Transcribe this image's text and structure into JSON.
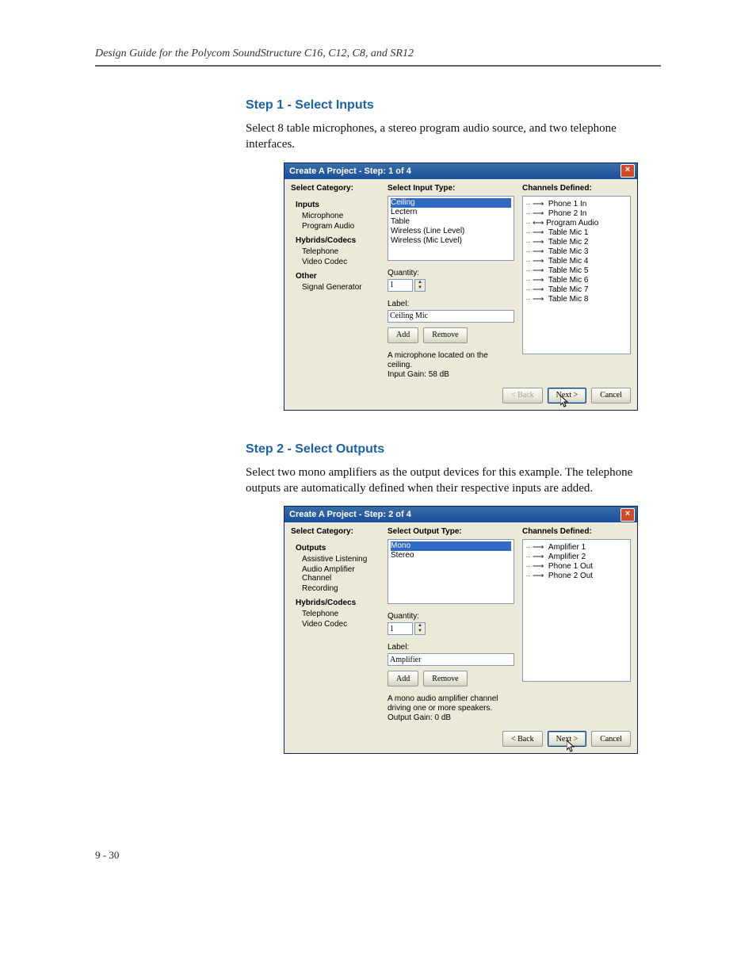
{
  "header": "Design Guide for the Polycom SoundStructure C16, C12, C8, and SR12",
  "step1": {
    "title": "Step 1 - Select Inputs",
    "paragraph": "Select 8 table microphones, a stereo program audio source, and two telephone interfaces.",
    "window_title": "Create A Project - Step: 1 of 4",
    "cat_head": "Select Category:",
    "type_head": "Select Input Type:",
    "ch_head": "Channels Defined:",
    "cats": {
      "g1": "Inputs",
      "g1a": "Microphone",
      "g1b": "Program Audio",
      "g2": "Hybrids/Codecs",
      "g2a": "Telephone",
      "g2b": "Video Codec",
      "g3": "Other",
      "g3a": "Signal Generator"
    },
    "types": {
      "t0": "Ceiling",
      "t1": "Lectern",
      "t2": "Table",
      "t3": "Wireless (Line Level)",
      "t4": "Wireless (Mic Level)"
    },
    "qty_label": "Quantity:",
    "qty": "1",
    "label_label": "Label:",
    "label": "Ceiling Mic",
    "add": "Add",
    "remove": "Remove",
    "desc1": "A microphone located on the ceiling.",
    "desc2": "Input Gain: 58 dB",
    "channels": {
      "c0": "Phone 1 In",
      "c1": "Phone 2 In",
      "c2": "Program Audio",
      "c3": "Table Mic 1",
      "c4": "Table Mic 2",
      "c5": "Table Mic 3",
      "c6": "Table Mic 4",
      "c7": "Table Mic 5",
      "c8": "Table Mic 6",
      "c9": "Table Mic 7",
      "c10": "Table Mic 8"
    },
    "back": "< Back",
    "next": "Next >",
    "cancel": "Cancel"
  },
  "step2": {
    "title": "Step 2 - Select Outputs",
    "paragraph": "Select two mono amplifiers as the output devices for this example. The tele­phone outputs are automatically defined when their respective inputs are added.",
    "window_title": "Create A Project - Step: 2 of 4",
    "cat_head": "Select Category:",
    "type_head": "Select Output Type:",
    "ch_head": "Channels Defined:",
    "cats": {
      "g1": "Outputs",
      "g1a": "Assistive Listening",
      "g1b": "Audio Amplifier Channel",
      "g1c": "Recording",
      "g2": "Hybrids/Codecs",
      "g2a": "Telephone",
      "g2b": "Video Codec"
    },
    "types": {
      "t0": "Mono",
      "t1": "Stereo"
    },
    "qty_label": "Quantity:",
    "qty": "1",
    "label_label": "Label:",
    "label": "Amplifier",
    "add": "Add",
    "remove": "Remove",
    "desc1": "A mono audio amplifier channel driving one or more speakers.",
    "desc2": "Output Gain: 0 dB",
    "channels": {
      "c0": "Amplifier 1",
      "c1": "Amplifier 2",
      "c2": "Phone 1 Out",
      "c3": "Phone 2 Out"
    },
    "back": "< Back",
    "next": "Next >",
    "cancel": "Cancel"
  },
  "pagenum": "9 - 30"
}
